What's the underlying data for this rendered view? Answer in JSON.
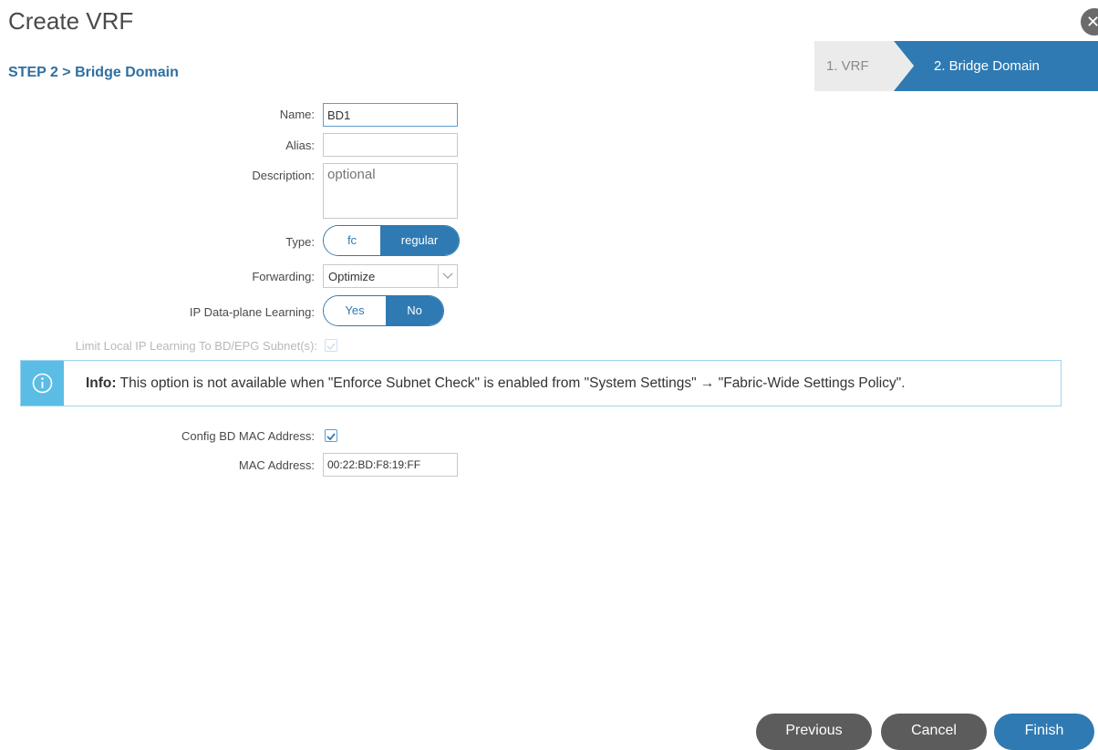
{
  "dialog": {
    "title": "Create VRF",
    "close_icon": "close-icon",
    "step_label": "STEP 2 > Bridge Domain"
  },
  "wizard": {
    "steps": [
      {
        "label": "1. VRF",
        "active": false
      },
      {
        "label": "2. Bridge Domain",
        "active": true
      }
    ]
  },
  "form": {
    "name": {
      "label": "Name:",
      "value": "BD1"
    },
    "alias": {
      "label": "Alias:",
      "value": ""
    },
    "description": {
      "label": "Description:",
      "placeholder": "optional",
      "value": ""
    },
    "type": {
      "label": "Type:",
      "options": [
        "fc",
        "regular"
      ],
      "selected": "regular"
    },
    "forwarding": {
      "label": "Forwarding:",
      "selected": "Optimize"
    },
    "ip_learning": {
      "label": "IP Data-plane Learning:",
      "options": [
        "Yes",
        "No"
      ],
      "selected": "No"
    },
    "limit_local": {
      "label": "Limit Local IP Learning To BD/EPG Subnet(s):",
      "checked": true,
      "disabled": true
    },
    "config_mac": {
      "label": "Config BD MAC Address:",
      "checked": true
    },
    "mac_address": {
      "label": "MAC Address:",
      "value": "00:22:BD:F8:19:FF"
    }
  },
  "info": {
    "prefix": "Info:",
    "text": " This option is not available when \"Enforce Subnet Check\" is enabled from \"System Settings\" → \"Fabric-Wide Settings Policy\".",
    "icon": "info-icon"
  },
  "footer": {
    "previous": "Previous",
    "cancel": "Cancel",
    "finish": "Finish"
  },
  "colors": {
    "accent": "#2f7ab2",
    "info": "#5bbde6",
    "button_gray": "#5c5c5c"
  }
}
